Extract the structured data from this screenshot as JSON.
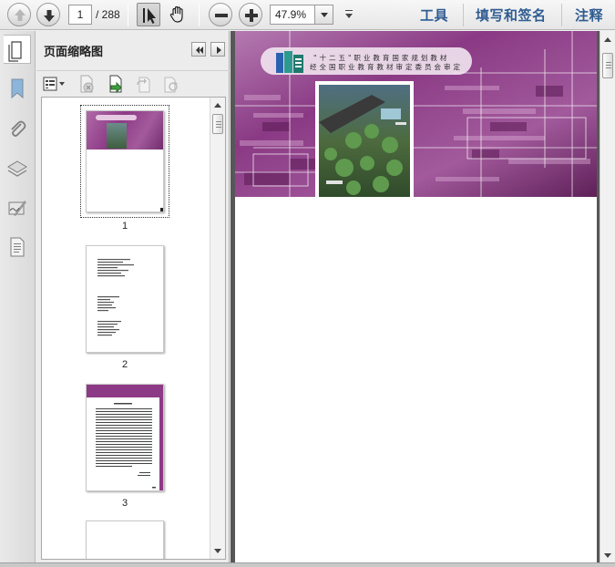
{
  "toolbar": {
    "page_current": "1",
    "page_total": "/ 288",
    "zoom_value": "47.9%",
    "tools_label": "工具",
    "fill_sign_label": "填写和签名",
    "comment_label": "注释"
  },
  "panel": {
    "title": "页面缩略图",
    "thumbnails": [
      {
        "label": "1"
      },
      {
        "label": "2"
      },
      {
        "label": "3"
      },
      {
        "label": ""
      }
    ]
  },
  "document": {
    "cover_line1": "\"十二五\"职业教育国家规划教材",
    "cover_line2": "经全国职业教育教材审定委员会审定"
  },
  "colors": {
    "toolbar_text": "#2f5c91",
    "cover_purple": "#8d3a86",
    "doc_background": "#575757"
  },
  "icons": {
    "rail": [
      "bookmark-icon",
      "attachment-icon",
      "layers-icon",
      "signature-icon",
      "page-icon"
    ],
    "panel_tools": [
      "thumbnail-options-icon",
      "delete-page-icon",
      "insert-page-icon",
      "rotate-left-icon",
      "rotate-right-icon"
    ]
  }
}
